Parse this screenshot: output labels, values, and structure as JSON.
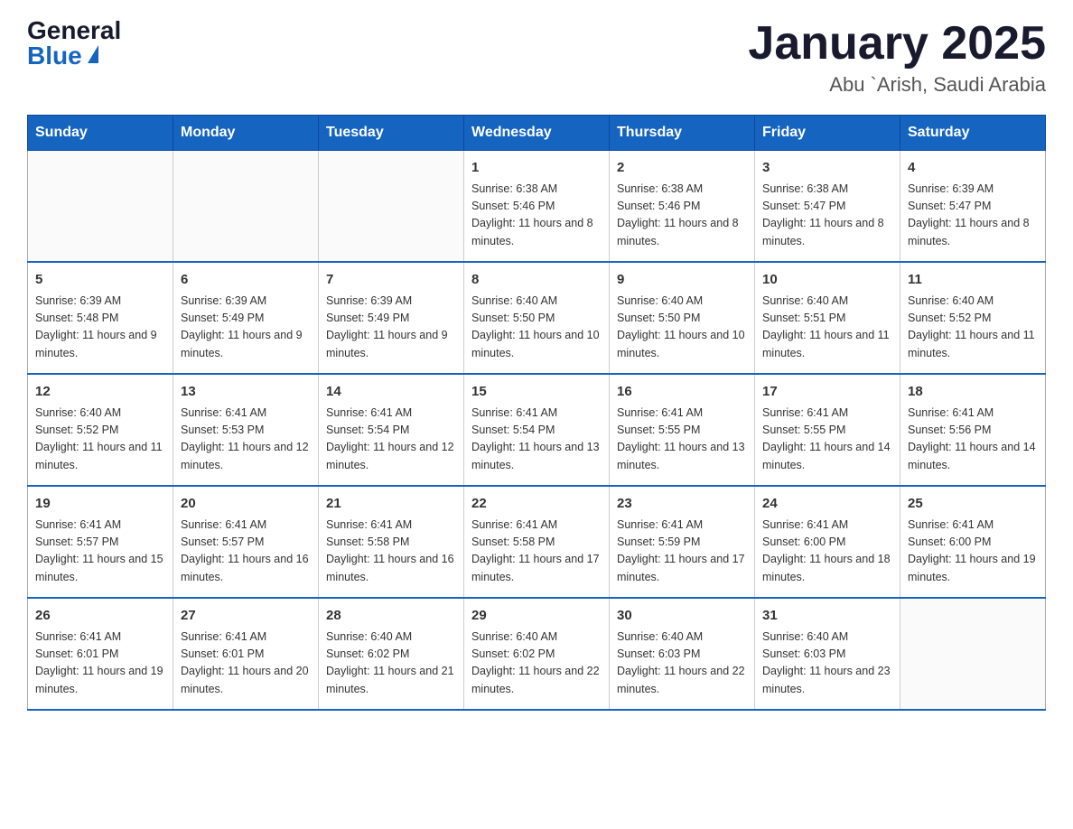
{
  "logo": {
    "general": "General",
    "blue": "Blue"
  },
  "header": {
    "title": "January 2025",
    "location": "Abu `Arish, Saudi Arabia"
  },
  "weekdays": [
    "Sunday",
    "Monday",
    "Tuesday",
    "Wednesday",
    "Thursday",
    "Friday",
    "Saturday"
  ],
  "weeks": [
    [
      {
        "day": "",
        "info": ""
      },
      {
        "day": "",
        "info": ""
      },
      {
        "day": "",
        "info": ""
      },
      {
        "day": "1",
        "info": "Sunrise: 6:38 AM\nSunset: 5:46 PM\nDaylight: 11 hours and 8 minutes."
      },
      {
        "day": "2",
        "info": "Sunrise: 6:38 AM\nSunset: 5:46 PM\nDaylight: 11 hours and 8 minutes."
      },
      {
        "day": "3",
        "info": "Sunrise: 6:38 AM\nSunset: 5:47 PM\nDaylight: 11 hours and 8 minutes."
      },
      {
        "day": "4",
        "info": "Sunrise: 6:39 AM\nSunset: 5:47 PM\nDaylight: 11 hours and 8 minutes."
      }
    ],
    [
      {
        "day": "5",
        "info": "Sunrise: 6:39 AM\nSunset: 5:48 PM\nDaylight: 11 hours and 9 minutes."
      },
      {
        "day": "6",
        "info": "Sunrise: 6:39 AM\nSunset: 5:49 PM\nDaylight: 11 hours and 9 minutes."
      },
      {
        "day": "7",
        "info": "Sunrise: 6:39 AM\nSunset: 5:49 PM\nDaylight: 11 hours and 9 minutes."
      },
      {
        "day": "8",
        "info": "Sunrise: 6:40 AM\nSunset: 5:50 PM\nDaylight: 11 hours and 10 minutes."
      },
      {
        "day": "9",
        "info": "Sunrise: 6:40 AM\nSunset: 5:50 PM\nDaylight: 11 hours and 10 minutes."
      },
      {
        "day": "10",
        "info": "Sunrise: 6:40 AM\nSunset: 5:51 PM\nDaylight: 11 hours and 11 minutes."
      },
      {
        "day": "11",
        "info": "Sunrise: 6:40 AM\nSunset: 5:52 PM\nDaylight: 11 hours and 11 minutes."
      }
    ],
    [
      {
        "day": "12",
        "info": "Sunrise: 6:40 AM\nSunset: 5:52 PM\nDaylight: 11 hours and 11 minutes."
      },
      {
        "day": "13",
        "info": "Sunrise: 6:41 AM\nSunset: 5:53 PM\nDaylight: 11 hours and 12 minutes."
      },
      {
        "day": "14",
        "info": "Sunrise: 6:41 AM\nSunset: 5:54 PM\nDaylight: 11 hours and 12 minutes."
      },
      {
        "day": "15",
        "info": "Sunrise: 6:41 AM\nSunset: 5:54 PM\nDaylight: 11 hours and 13 minutes."
      },
      {
        "day": "16",
        "info": "Sunrise: 6:41 AM\nSunset: 5:55 PM\nDaylight: 11 hours and 13 minutes."
      },
      {
        "day": "17",
        "info": "Sunrise: 6:41 AM\nSunset: 5:55 PM\nDaylight: 11 hours and 14 minutes."
      },
      {
        "day": "18",
        "info": "Sunrise: 6:41 AM\nSunset: 5:56 PM\nDaylight: 11 hours and 14 minutes."
      }
    ],
    [
      {
        "day": "19",
        "info": "Sunrise: 6:41 AM\nSunset: 5:57 PM\nDaylight: 11 hours and 15 minutes."
      },
      {
        "day": "20",
        "info": "Sunrise: 6:41 AM\nSunset: 5:57 PM\nDaylight: 11 hours and 16 minutes."
      },
      {
        "day": "21",
        "info": "Sunrise: 6:41 AM\nSunset: 5:58 PM\nDaylight: 11 hours and 16 minutes."
      },
      {
        "day": "22",
        "info": "Sunrise: 6:41 AM\nSunset: 5:58 PM\nDaylight: 11 hours and 17 minutes."
      },
      {
        "day": "23",
        "info": "Sunrise: 6:41 AM\nSunset: 5:59 PM\nDaylight: 11 hours and 17 minutes."
      },
      {
        "day": "24",
        "info": "Sunrise: 6:41 AM\nSunset: 6:00 PM\nDaylight: 11 hours and 18 minutes."
      },
      {
        "day": "25",
        "info": "Sunrise: 6:41 AM\nSunset: 6:00 PM\nDaylight: 11 hours and 19 minutes."
      }
    ],
    [
      {
        "day": "26",
        "info": "Sunrise: 6:41 AM\nSunset: 6:01 PM\nDaylight: 11 hours and 19 minutes."
      },
      {
        "day": "27",
        "info": "Sunrise: 6:41 AM\nSunset: 6:01 PM\nDaylight: 11 hours and 20 minutes."
      },
      {
        "day": "28",
        "info": "Sunrise: 6:40 AM\nSunset: 6:02 PM\nDaylight: 11 hours and 21 minutes."
      },
      {
        "day": "29",
        "info": "Sunrise: 6:40 AM\nSunset: 6:02 PM\nDaylight: 11 hours and 22 minutes."
      },
      {
        "day": "30",
        "info": "Sunrise: 6:40 AM\nSunset: 6:03 PM\nDaylight: 11 hours and 22 minutes."
      },
      {
        "day": "31",
        "info": "Sunrise: 6:40 AM\nSunset: 6:03 PM\nDaylight: 11 hours and 23 minutes."
      },
      {
        "day": "",
        "info": ""
      }
    ]
  ]
}
